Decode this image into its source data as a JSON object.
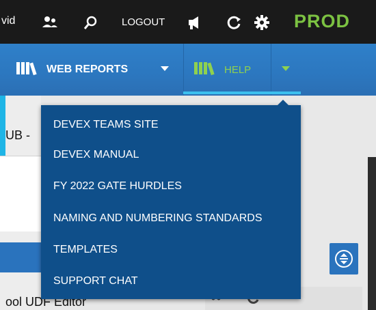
{
  "topbar": {
    "user_fragment": "vid",
    "logout_label": "LOGOUT",
    "environment": "PROD",
    "icons": [
      "users-icon",
      "search-icon",
      "megaphone-icon",
      "refresh-icon",
      "gear-icon"
    ]
  },
  "nav": {
    "web_reports_label": "WEB REPORTS",
    "help_label": "HELP"
  },
  "background": {
    "tab_fragment": "UB -",
    "editor_fragment": "ool UDF Editor"
  },
  "help_menu": {
    "items": [
      "DEVEX TEAMS SITE",
      "DEVEX MANUAL",
      "FY 2022 GATE HURDLES",
      "NAMING AND NUMBERING STANDARDS",
      "TEMPLATES",
      "SUPPORT CHAT"
    ]
  },
  "colors": {
    "top_bar": "#1a1a1a",
    "nav_blue": "#2f80c9",
    "dropdown_blue": "#0f4f8a",
    "prod_green": "#7cc242",
    "help_green": "#8fd14f",
    "active_underline": "#3cc0ee"
  }
}
